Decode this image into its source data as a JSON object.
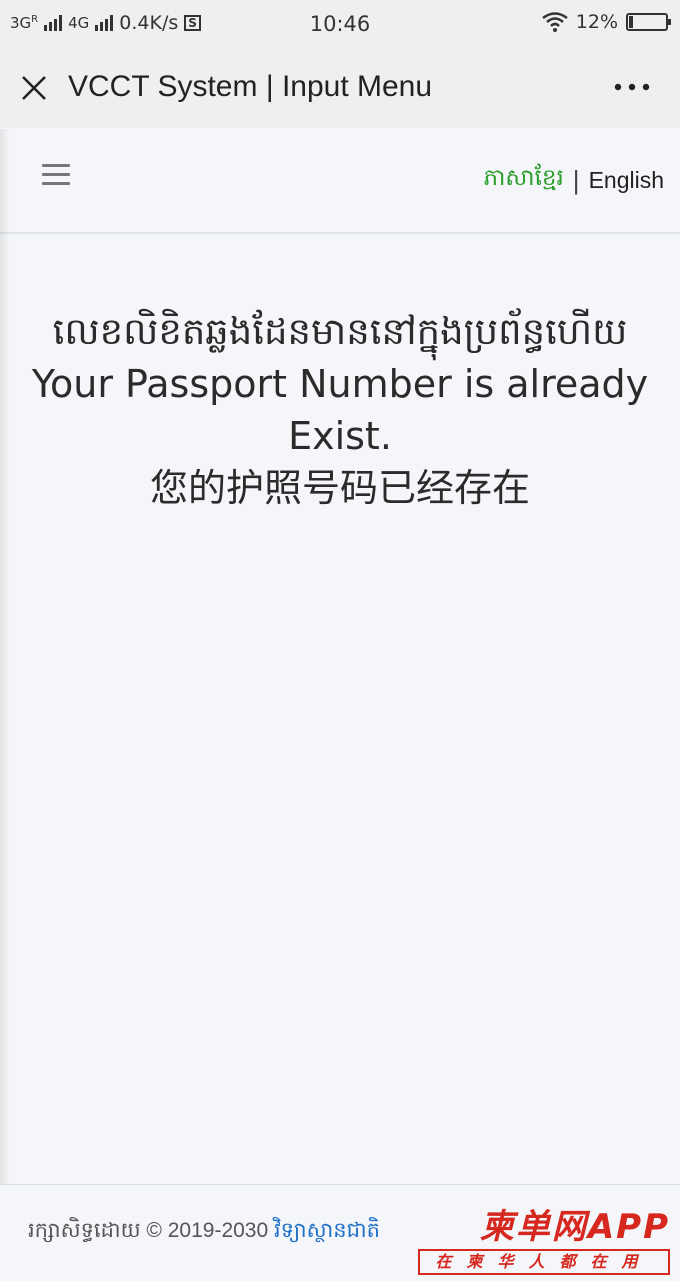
{
  "status_bar": {
    "network_left": "3G",
    "network_left_sup": "R",
    "network_right": "4G",
    "speed": "0.4K/s",
    "s_icon_text": "S",
    "time": "10:46",
    "battery": "12%",
    "battery_level": 0.12
  },
  "title_bar": {
    "title": "VCCT System | Input Menu",
    "close_icon": "close-icon",
    "more_icon": "more-icon"
  },
  "navbar": {
    "menu_icon": "hamburger-icon",
    "lang_khmer": "ភាសាខ្មែរ",
    "separator": "|",
    "lang_english": "English",
    "khmer_color": "#2a9d2a"
  },
  "message": {
    "khmer": "លេខលិខិតឆ្លងដែនមាននៅក្នុងប្រព័ន្ធហើយ",
    "english": "Your Passport Number is already Exist.",
    "chinese": "您的护照号码已经存在"
  },
  "footer": {
    "prefix": "រក្សាសិទ្ធដោយ © 2019-2030",
    "link": "វិទ្យាស្ថានជាតិ",
    "link_color": "#1e6fc8"
  },
  "watermark": {
    "main": "柬单网APP",
    "sub": "在柬华人都在用",
    "color": "#d6281e"
  }
}
